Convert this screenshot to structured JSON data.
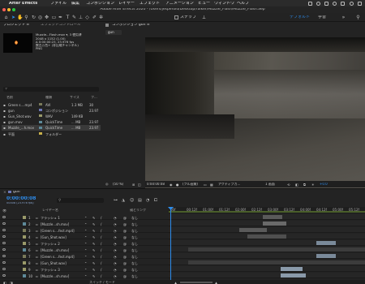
{
  "menubar": {
    "app": "After Effects",
    "items": [
      "ファイル",
      "編集",
      "コンポジション",
      "レイヤー",
      "エフェクト",
      "アニメーション",
      "ビュー",
      "ウィンドウ",
      "ヘルプ"
    ]
  },
  "titlebar": {
    "title": "Adobe After Effects 2020 - /Users/jesperold/Desktop/ralker/Muzzle_Flash/Muzzle_Flash.aep"
  },
  "toolbar": {
    "snap_label": "スナップ",
    "workspaces": [
      "デフォルト",
      "学習"
    ],
    "active_workspace": "デフォルト"
  },
  "project": {
    "tab_project": "プロジェクト ≡",
    "tab_effects": "エフェクトコントロール",
    "info": {
      "name": "Muzzle...Flash.mov ▾, 3 使用済",
      "size": "2048 x 1152 (1.00)",
      "duration": "Δ 0:00:00:23, 23.976 fps",
      "audio": "数百万色+ (非圧縮チャンネル)",
      "codec": "PNG"
    },
    "columns": {
      "name": "名前",
      "type": "種類",
      "size": "サイズ",
      "fps": "フ..."
    },
    "items": [
      {
        "name": "Green s....mp4",
        "type": "AVI",
        "size": "1.3 MB",
        "fps": "30",
        "color": "#7a7a5a",
        "icon": "film-icon"
      },
      {
        "name": "gun",
        "type": "コンポジション",
        "size": "",
        "fps": "23.97",
        "color": "#6d78b8",
        "icon": "comp-icon"
      },
      {
        "name": "Gun_Shot.wav",
        "type": "WAV",
        "size": "149 KB",
        "fps": "",
        "color": "#9a9a6a",
        "icon": "audio-icon"
      },
      {
        "name": "gun.mov",
        "type": "QuickTime",
        "size": "... MB",
        "fps": "23.97",
        "color": "#5e8a9a",
        "icon": "film-icon"
      },
      {
        "name": "Muzzle_...h.mov",
        "type": "QuickTime",
        "size": "... MB",
        "fps": "23.97",
        "color": "#5e8a9a",
        "icon": "film-icon",
        "selected": true
      },
      {
        "name": "平面",
        "type": "フォルダー",
        "size": "",
        "fps": "",
        "color": "#c8b04a",
        "icon": "folder-icon"
      }
    ],
    "bpc": "8 bpc"
  },
  "comp": {
    "tab_label": "コンポジション gun ≡",
    "subtab": "gun",
    "zoom": "(50 %)",
    "timecode": "0:00:00:08",
    "resolution": "(フル画質)",
    "camera": "アクティブカ...",
    "views": "1 画面",
    "offset": "+0.0"
  },
  "timeline": {
    "tab": "gun",
    "timecode": "0:00:00:08",
    "subtimecode": "00008 (23.976 fps)",
    "columns": {
      "layer": "レイヤー名",
      "parent": "親とリンク"
    },
    "ruler": [
      "00f",
      "00:12f",
      "01:00f",
      "01:12f",
      "02:00f",
      "02:12f",
      "03:00f",
      "03:12f",
      "04:00f",
      "04:12f",
      "05:00f",
      "05:12f"
    ],
    "layers": [
      {
        "num": "1",
        "name": "フラッシュ 1",
        "parent": "なし",
        "color": "#9a9a6a",
        "bar": [
          48,
          58
        ],
        "bar_color": "#5a5a5a"
      },
      {
        "num": "2",
        "name": "[Muzzle...sh.mov]",
        "parent": "なし",
        "color": "#5e8a9a",
        "bar": [
          48,
          60
        ],
        "bar_color": "#6a6a6a"
      },
      {
        "num": "3",
        "name": "[Green s....fect.mp4]",
        "parent": "なし",
        "color": "#7a7a5a",
        "bar": [
          36,
          50
        ],
        "bar_color": "#5a5a5a"
      },
      {
        "num": "4",
        "name": "[Gun_Shot.wav]",
        "parent": "なし",
        "color": "#9a9a6a",
        "bar": [
          40,
          60
        ],
        "bar_color": "#4f4f4f"
      },
      {
        "num": "5",
        "name": "フラッシュ 2",
        "parent": "なし",
        "color": "#9a9a6a",
        "bar": [
          75,
          85
        ],
        "bar_color": "#7a8a9a"
      },
      {
        "num": "6",
        "name": "[Muzzle...sh.mov]",
        "parent": "なし",
        "color": "#5e8a9a",
        "bar": [
          10,
          100
        ],
        "bar_color": "#3c3c3c"
      },
      {
        "num": "7",
        "name": "[Green s....fect.mp4]",
        "parent": "なし",
        "color": "#7a7a5a",
        "bar": [
          75,
          85
        ],
        "bar_color": "#7a8a9a"
      },
      {
        "num": "8",
        "name": "[Gun_Shot.wav]",
        "parent": "なし",
        "color": "#9a9a6a",
        "bar": [
          10,
          100
        ],
        "bar_color": "#3c3c3c"
      },
      {
        "num": "9",
        "name": "フラッシュ 3",
        "parent": "なし",
        "color": "#9a9a6a",
        "bar": [
          57,
          68
        ],
        "bar_color": "#8a9aaa"
      },
      {
        "num": "10",
        "name": "[Muzzle...sh.mov]",
        "parent": "なし",
        "color": "#5e8a9a",
        "bar": [
          57,
          70
        ],
        "bar_color": "#8a9aaa"
      }
    ],
    "footer": "スイッチ / モード"
  },
  "colors": {
    "accent": "#2d8ceb"
  }
}
